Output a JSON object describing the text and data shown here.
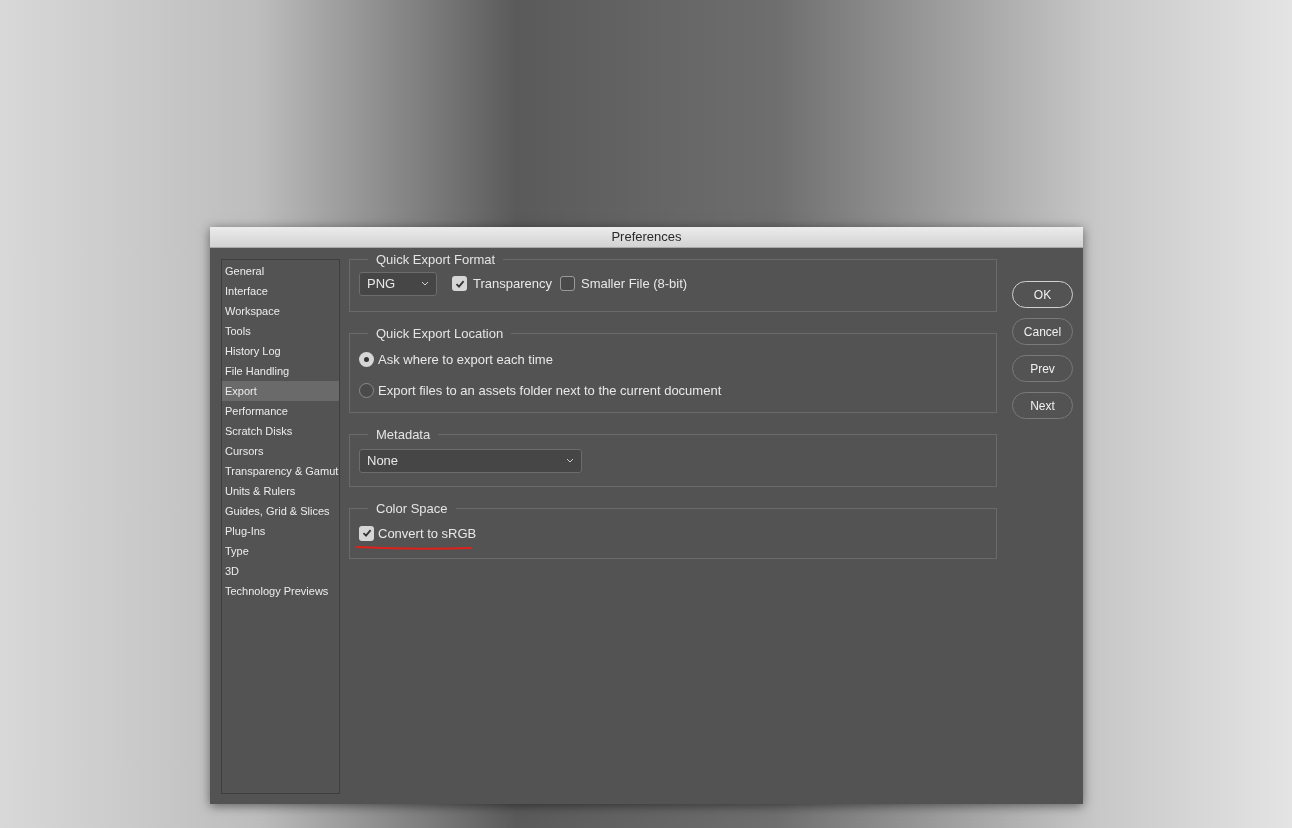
{
  "window": {
    "title": "Preferences"
  },
  "sidebar": {
    "items": [
      {
        "label": "General",
        "selected": false
      },
      {
        "label": "Interface",
        "selected": false
      },
      {
        "label": "Workspace",
        "selected": false
      },
      {
        "label": "Tools",
        "selected": false
      },
      {
        "label": "History Log",
        "selected": false
      },
      {
        "label": "File Handling",
        "selected": false
      },
      {
        "label": "Export",
        "selected": true
      },
      {
        "label": "Performance",
        "selected": false
      },
      {
        "label": "Scratch Disks",
        "selected": false
      },
      {
        "label": "Cursors",
        "selected": false
      },
      {
        "label": "Transparency & Gamut",
        "selected": false
      },
      {
        "label": "Units & Rulers",
        "selected": false
      },
      {
        "label": "Guides, Grid & Slices",
        "selected": false
      },
      {
        "label": "Plug-Ins",
        "selected": false
      },
      {
        "label": "Type",
        "selected": false
      },
      {
        "label": "3D",
        "selected": false
      },
      {
        "label": "Technology Previews",
        "selected": false
      }
    ]
  },
  "quick_export_format": {
    "title": "Quick Export Format",
    "format_select": {
      "value": "PNG"
    },
    "checkboxes": [
      {
        "label": "Transparency",
        "checked": true
      },
      {
        "label": "Smaller File (8-bit)",
        "checked": false
      }
    ]
  },
  "quick_export_location": {
    "title": "Quick Export Location",
    "options": [
      {
        "label": "Ask where to export each time",
        "selected": true
      },
      {
        "label": "Export files to an assets folder next to the current document",
        "selected": false
      }
    ]
  },
  "metadata": {
    "title": "Metadata",
    "select": {
      "value": "None"
    }
  },
  "color_space": {
    "title": "Color Space",
    "checkbox": {
      "label": "Convert to sRGB",
      "checked": true
    }
  },
  "buttons": [
    {
      "label": "OK",
      "default": true
    },
    {
      "label": "Cancel",
      "default": false
    },
    {
      "label": "Prev",
      "default": false
    },
    {
      "label": "Next",
      "default": false
    }
  ]
}
